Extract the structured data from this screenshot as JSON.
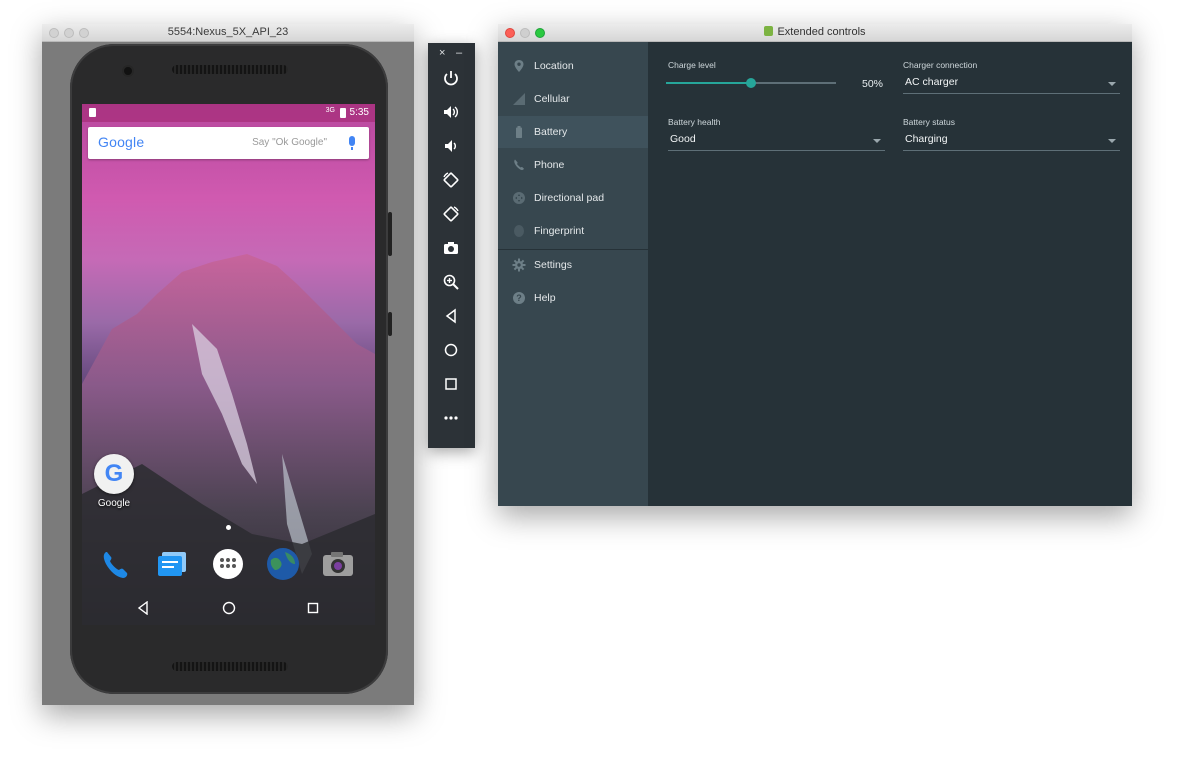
{
  "emulator": {
    "window_title": "5554:Nexus_5X_API_23",
    "status_time": "5:35",
    "status_network": "3G",
    "search_logo": "Google",
    "search_hint": "Say \"Ok Google\"",
    "home_app_label": "Google",
    "dock_icons": [
      "phone-icon",
      "messages-icon",
      "apps-icon",
      "browser-icon",
      "camera-icon"
    ],
    "nav_icons": [
      "back-icon",
      "home-icon",
      "recents-icon"
    ]
  },
  "toolbar": {
    "close": "×",
    "minimize": "–",
    "buttons": [
      "power-icon",
      "volume-up-icon",
      "volume-down-icon",
      "rotate-left-icon",
      "rotate-right-icon",
      "screenshot-icon",
      "zoom-icon",
      "back-icon",
      "home-icon",
      "overview-icon",
      "more-icon"
    ]
  },
  "extended_controls": {
    "window_title": "Extended controls",
    "sidebar": [
      {
        "label": "Location",
        "icon": "location-icon"
      },
      {
        "label": "Cellular",
        "icon": "cellular-icon"
      },
      {
        "label": "Battery",
        "icon": "battery-icon"
      },
      {
        "label": "Phone",
        "icon": "phone-icon"
      },
      {
        "label": "Directional pad",
        "icon": "dpad-icon"
      },
      {
        "label": "Fingerprint",
        "icon": "fingerprint-icon"
      },
      {
        "label": "Settings",
        "icon": "settings-icon"
      },
      {
        "label": "Help",
        "icon": "help-icon"
      }
    ],
    "active_item": "Battery",
    "battery": {
      "charge_level_label": "Charge level",
      "charge_level": 0.5,
      "charge_level_text": "50%",
      "charger_connection_label": "Charger connection",
      "charger_connection": "AC charger",
      "battery_health_label": "Battery health",
      "battery_health": "Good",
      "battery_status_label": "Battery status",
      "battery_status": "Charging"
    },
    "accent_color": "#26a69a"
  }
}
